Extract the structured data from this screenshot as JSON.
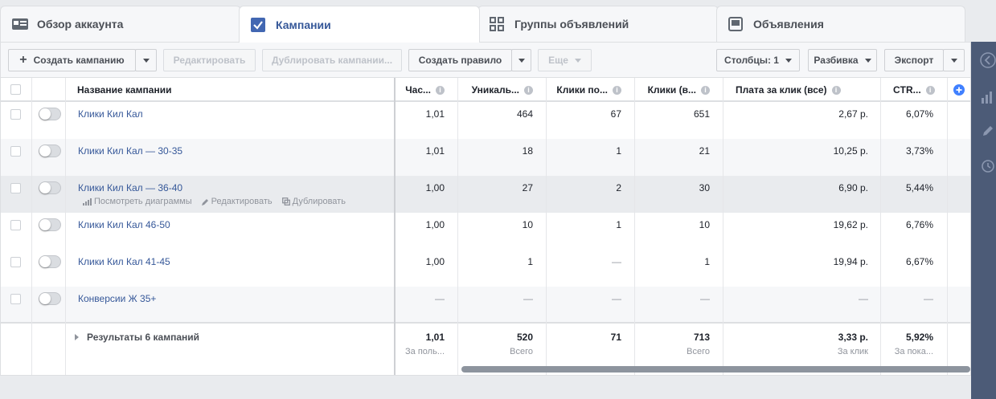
{
  "tabs": [
    {
      "label": "Обзор аккаунта",
      "icon": "account-overview-icon"
    },
    {
      "label": "Кампании",
      "icon": "checkbox-icon"
    },
    {
      "label": "Группы объявлений",
      "icon": "grid-icon"
    },
    {
      "label": "Объявления",
      "icon": "ad-icon"
    }
  ],
  "toolbar": {
    "create": "Создать кампанию",
    "edit": "Редактировать",
    "duplicate": "Дублировать кампании...",
    "create_rule": "Создать правило",
    "more": "Еще",
    "columns": "Столбцы: 1",
    "breakdown": "Разбивка",
    "export": "Экспорт"
  },
  "table": {
    "headers": [
      "Название кампании",
      "Час...",
      "Уникаль...",
      "Клики по...",
      "Клики (в...",
      "Плата за клик (все)",
      "CTR..."
    ],
    "rows": [
      {
        "name": "Клики Кил Кал",
        "freq": "1,01",
        "unique": "464",
        "link_clicks": "67",
        "clicks_all": "651",
        "cpc": "2,67 р.",
        "ctr": "6,07%"
      },
      {
        "name": "Клики Кил Кал — 30-35",
        "freq": "1,01",
        "unique": "18",
        "link_clicks": "1",
        "clicks_all": "21",
        "cpc": "10,25 р.",
        "ctr": "3,73%"
      },
      {
        "name": "Клики Кил Кал — 36-40",
        "freq": "1,00",
        "unique": "27",
        "link_clicks": "2",
        "clicks_all": "30",
        "cpc": "6,90 р.",
        "ctr": "5,44%"
      },
      {
        "name": "Клики Кил Кал 46-50",
        "freq": "1,00",
        "unique": "10",
        "link_clicks": "1",
        "clicks_all": "10",
        "cpc": "19,62 р.",
        "ctr": "6,76%"
      },
      {
        "name": "Клики Кил Кал 41-45",
        "freq": "1,00",
        "unique": "1",
        "link_clicks": "—",
        "clicks_all": "1",
        "cpc": "19,94 р.",
        "ctr": "6,67%"
      },
      {
        "name": "Конверсии Ж 35+",
        "freq": "—",
        "unique": "—",
        "link_clicks": "—",
        "clicks_all": "—",
        "cpc": "—",
        "ctr": "—"
      }
    ],
    "row_actions": {
      "view_charts": "Посмотреть диаграммы",
      "edit": "Редактировать",
      "duplicate": "Дублировать"
    },
    "summary": {
      "label": "Результаты 6 кампаний",
      "freq": "1,01",
      "freq_sub": "За поль...",
      "unique": "520",
      "unique_sub": "Всего",
      "link_clicks": "71",
      "clicks_all": "713",
      "clicks_all_sub": "Всего",
      "cpc": "3,33 р.",
      "cpc_sub": "За клик",
      "ctr": "5,92%",
      "ctr_sub": "За пока..."
    }
  },
  "colors": {
    "link": "#365899",
    "sidebar": "#4c5b77",
    "accent": "#4080ff"
  }
}
